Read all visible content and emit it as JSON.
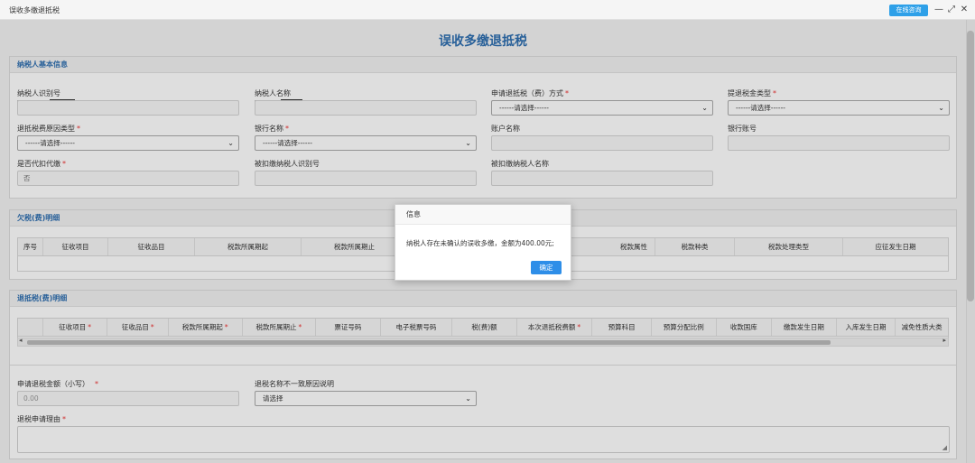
{
  "window": {
    "title": "误收多缴退抵税",
    "consult_label": "在线咨询",
    "minimize_glyph": "—",
    "restore_glyph": "⤢",
    "close_glyph": "✕"
  },
  "page_title": "误收多缴退抵税",
  "taxpayer_section": {
    "title": "纳税人基本信息",
    "fields": {
      "taxpayer_id": {
        "label": "纳税人识别号",
        "value": ""
      },
      "taxpayer_name": {
        "label": "纳税人名称",
        "value": ""
      },
      "refund_method": {
        "label": "申请退抵税（费）方式",
        "value": "------请选择------"
      },
      "refund_amount_type": {
        "label": "提退税金类型",
        "value": "------请选择------"
      },
      "refund_reason_type": {
        "label": "退抵税费原因类型",
        "value": "------请选择------"
      },
      "bank_name": {
        "label": "银行名称",
        "value": "------请选择------"
      },
      "account_name": {
        "label": "账户名称",
        "value": ""
      },
      "bank_account": {
        "label": "银行账号",
        "value": ""
      },
      "is_withholding": {
        "label": "是否代扣代缴",
        "value": "否"
      },
      "withheld_taxpayer_id": {
        "label": "被扣缴纳税人识别号",
        "value": ""
      },
      "withheld_taxpayer_name": {
        "label": "被扣缴纳税人名称",
        "value": ""
      }
    }
  },
  "arrears_section": {
    "title": "欠税(费)明细",
    "columns": [
      "序号",
      "征收项目",
      "征收品目",
      "税款所属期起",
      "税款所属期止",
      "税款属性",
      "税款种类",
      "税款处理类型",
      "应征发生日期"
    ]
  },
  "refund_section": {
    "title": "退抵税(费)明细",
    "columns": [
      {
        "label": "",
        "required": false
      },
      {
        "label": "征收项目",
        "required": true
      },
      {
        "label": "征收品目",
        "required": true
      },
      {
        "label": "税款所属期起",
        "required": true
      },
      {
        "label": "税款所属期止",
        "required": true
      },
      {
        "label": "票证号码",
        "required": false
      },
      {
        "label": "电子税票号码",
        "required": false
      },
      {
        "label": "税(费)额",
        "required": false
      },
      {
        "label": "本次退抵税费额",
        "required": true
      },
      {
        "label": "预算科目",
        "required": false
      },
      {
        "label": "预算分配比例",
        "required": false
      },
      {
        "label": "收款国库",
        "required": false
      },
      {
        "label": "缴款发生日期",
        "required": false
      },
      {
        "label": "入库发生日期",
        "required": false
      },
      {
        "label": "减免性质大类",
        "required": false
      }
    ],
    "scroll_left": "◂",
    "scroll_right": "▸"
  },
  "apply_section": {
    "amount_label": "申请退税金额（小写）",
    "amount_value": "0.00",
    "name_mismatch_label": "退税名称不一致原因说明",
    "name_mismatch_value": "请选择",
    "reason_label": "退税申请理由"
  },
  "dialog": {
    "title": "信息",
    "message": "纳税人存在未确认的误收多缴，金额为400.00元;",
    "ok_label": "确定"
  },
  "icons": {
    "caret": "⌄",
    "resize_grip": "◢"
  },
  "colors": {
    "accent": "#2f6fb0",
    "button": "#2e8ee8",
    "required": "#e33333"
  }
}
